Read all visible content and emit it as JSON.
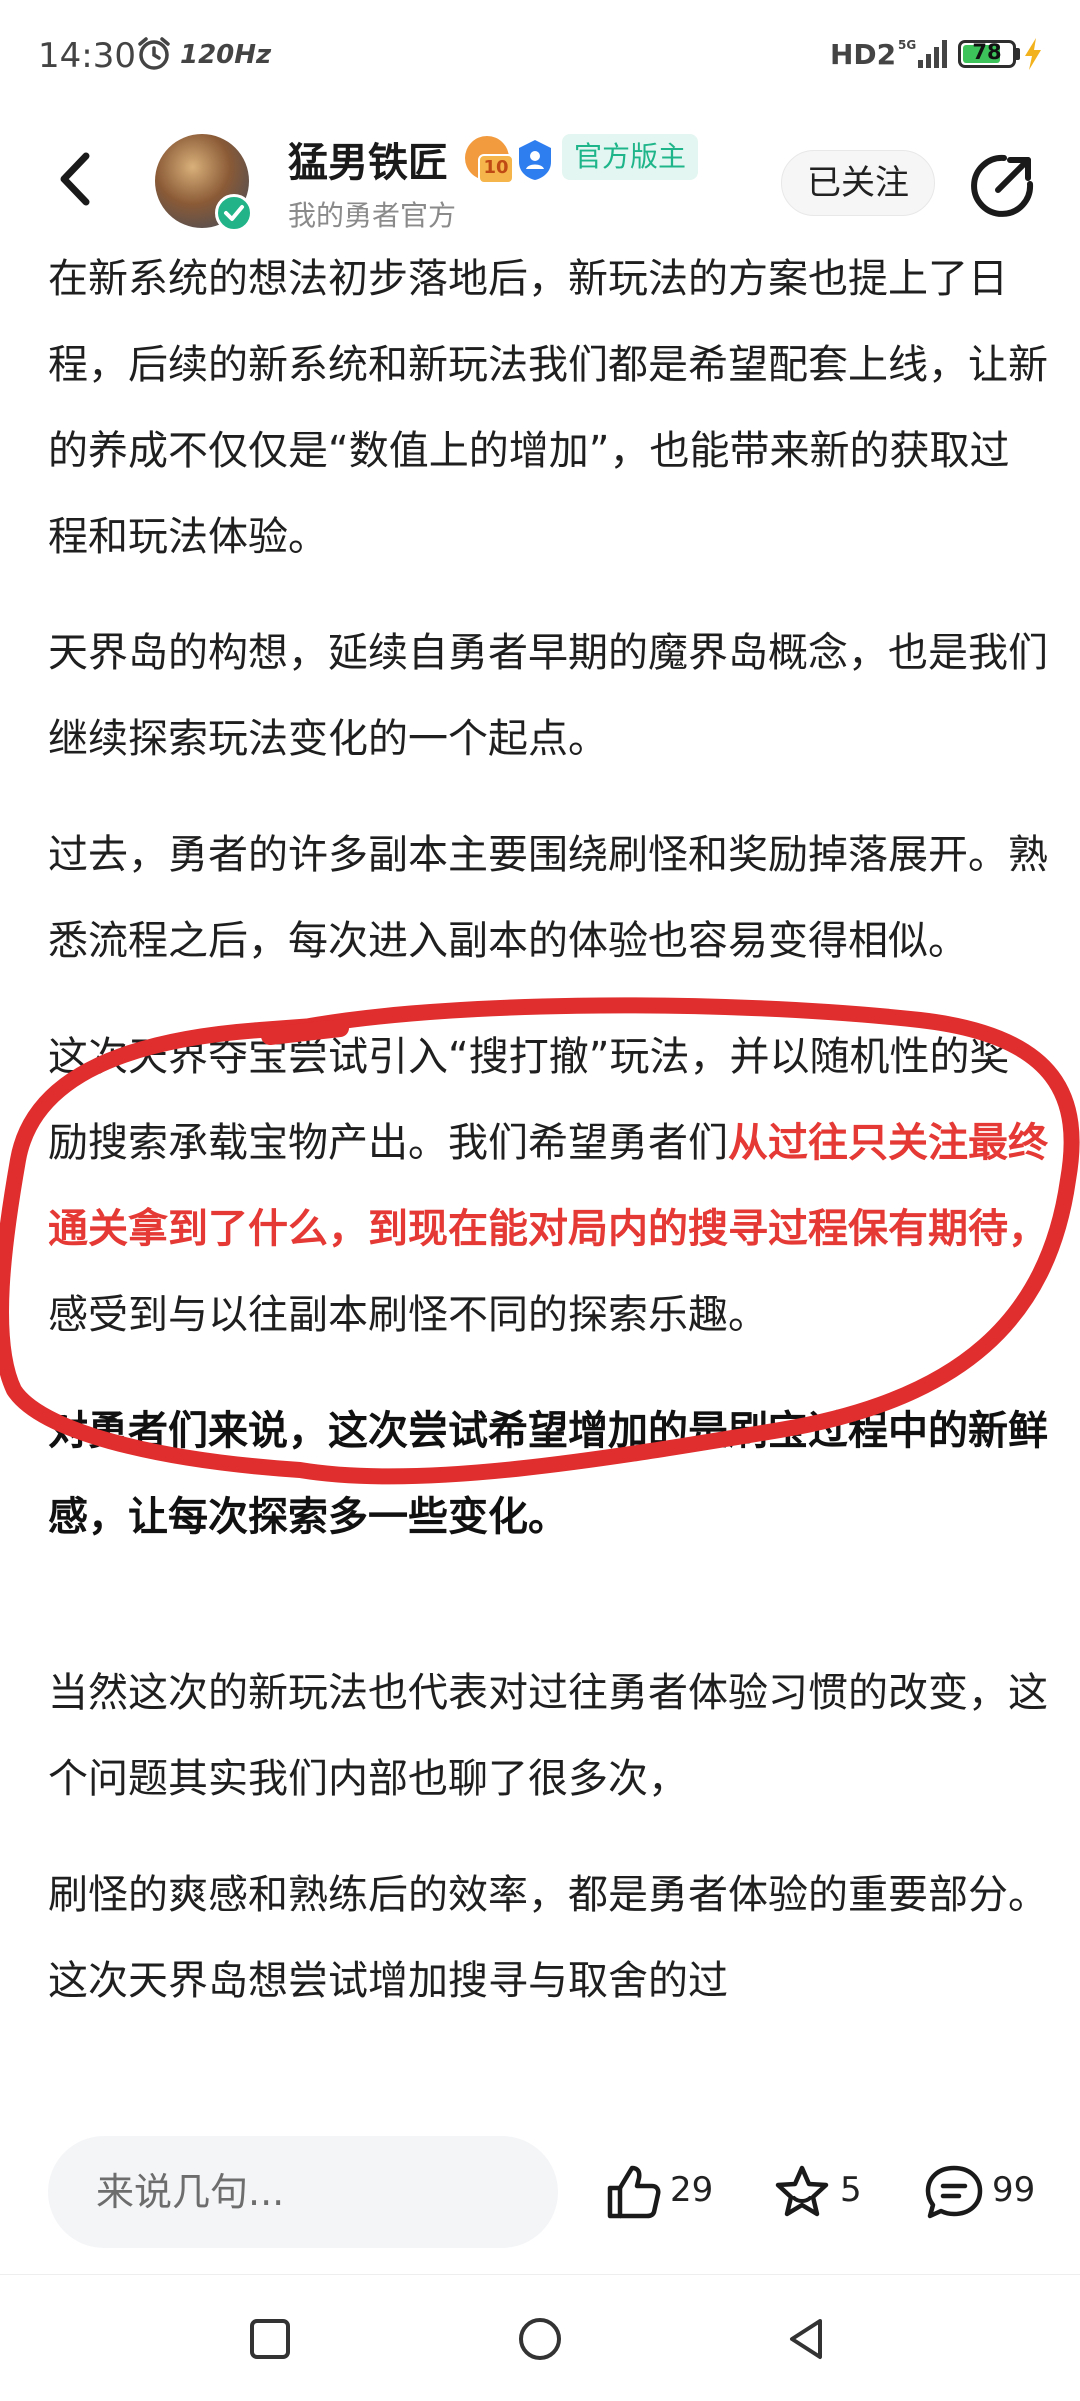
{
  "status_bar": {
    "time": "14:30",
    "refresh_rate": "120Hz",
    "network": "HD2",
    "battery": "78",
    "battery_level": 0.78,
    "icons": [
      "alarm-icon",
      "signal-icon",
      "battery-icon",
      "charging-bolt-icon"
    ]
  },
  "header": {
    "back_icon": "chevron-left-icon",
    "author_name": "猛男铁匠",
    "level": "10",
    "role_badge": "官方版主",
    "subtitle": "我的勇者官方",
    "follow_label": "已关注",
    "share_icon": "share-icon"
  },
  "article": {
    "p1": "在新系统的想法初步落地后，新玩法的方案也提上了日程，后续的新系统和新玩法我们都是希望配套上线，让新的养成不仅仅是“数值上的增加”，也能带来新的获取过程和玩法体验。",
    "p2": "天界岛的构想，延续自勇者早期的魔界岛概念，也是我们继续探索玩法变化的一个起点。",
    "p3": "过去，勇者的许多副本主要围绕刷怪和奖励掉落展开。熟悉流程之后，每次进入副本的体验也容易变得相似。",
    "p4_a": "这次天界夺宝尝试引入“搜打撤”玩法，并以随机性的奖励搜索承载宝物产出。我们希望勇者们",
    "p4_highlight": "从过往只关注最终通关拿到了什么，到现在能对局内的搜寻过程保有期待，",
    "p4_b": "感受到与以往副本刷怪不同的探索乐趣。",
    "p5": "对勇者们来说，这次尝试希望增加的是刷宝过程中的新鲜感，让每次探索多一些变化。",
    "p6": "当然这次的新玩法也代表对过往勇者体验习惯的改变，这个问题其实我们内部也聊了很多次，",
    "p7": "刷怪的爽感和熟练后的效率，都是勇者体验的重要部分。这次天界岛想尝试增加搜寻与取舍的过",
    "accent_color": "#e53935",
    "annotation_color": "#e02d2d"
  },
  "bottom_bar": {
    "comment_placeholder": "来说几句...",
    "like_count": "29",
    "favorite_count": "5",
    "comment_count": "99"
  },
  "nav_bar": {
    "items": [
      "recent-apps-icon",
      "home-icon",
      "back-icon"
    ]
  }
}
